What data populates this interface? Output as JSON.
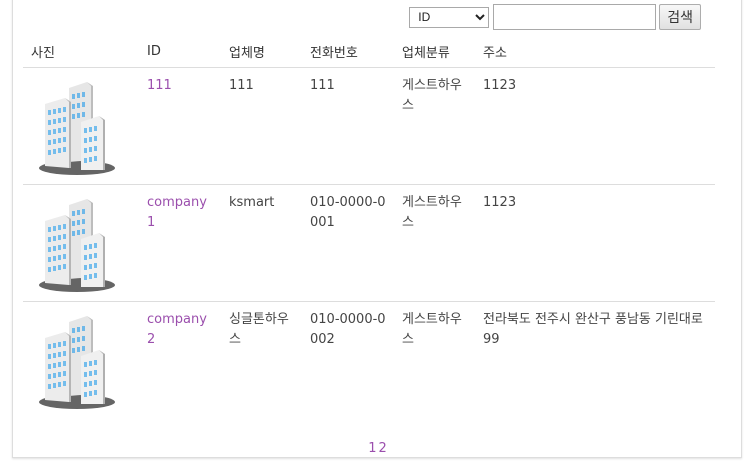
{
  "search": {
    "selected_option": "ID",
    "input_value": "",
    "button_label": "검색"
  },
  "table": {
    "headers": [
      "사진",
      "ID",
      "업체명",
      "전화번호",
      "업체분류",
      "주소"
    ],
    "rows": [
      {
        "photo_icon": "building-icon",
        "id": "111",
        "name": "111",
        "phone": "111",
        "category": "게스트하우스",
        "address": "1123"
      },
      {
        "photo_icon": "building-icon",
        "id": "company1",
        "name": "ksmart",
        "phone": "010-0000-0001",
        "category": "게스트하우스",
        "address": "1123"
      },
      {
        "photo_icon": "building-icon",
        "id": "company2",
        "name": "싱글톤하우스",
        "phone": "010-0000-0002",
        "category": "게스트하우스",
        "address": "전라북도 전주시 완산구 풍남동 기린대로 99"
      }
    ]
  },
  "pagination": {
    "pages": [
      "1",
      "2"
    ]
  },
  "colors": {
    "link": "#9b4fad",
    "border": "#dddddd"
  }
}
